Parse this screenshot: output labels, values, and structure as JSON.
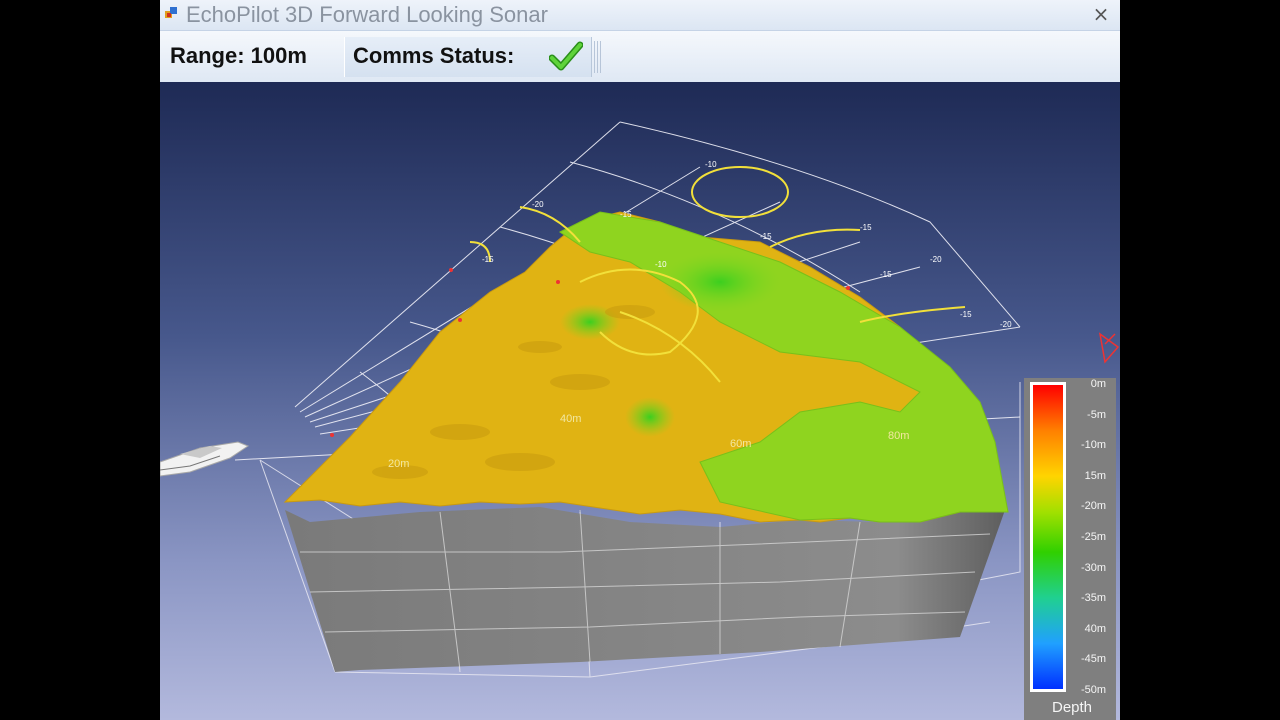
{
  "window": {
    "title": "EchoPilot 3D Forward Looking Sonar",
    "close_glyph": "×"
  },
  "toolbar": {
    "range_text": "Range: 100m",
    "comms_label": "Comms Status:",
    "comms_status": "ok",
    "comms_icon": "green-check-icon"
  },
  "scene": {
    "range_labels": [
      "20m",
      "40m",
      "60m",
      "80m"
    ],
    "contour_labels": [
      "-20",
      "-15",
      "-15",
      "-10",
      "-15",
      "-15",
      "-20",
      "-15",
      "-10",
      "-15",
      "-20"
    ]
  },
  "legend": {
    "title": "Depth",
    "ticks": [
      "0m",
      "-5m",
      "-10m",
      "15m",
      "-20m",
      "-25m",
      "-30m",
      "-35m",
      "40m",
      "-45m",
      "-50m"
    ],
    "gradient_colors": [
      "#ff0000",
      "#ff8000",
      "#ffd400",
      "#a0e000",
      "#30d000",
      "#20d090",
      "#20a0ff",
      "#0030ff"
    ]
  },
  "boat": {
    "icon": "boat-icon"
  }
}
